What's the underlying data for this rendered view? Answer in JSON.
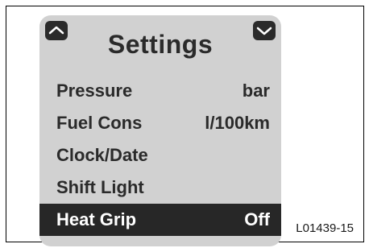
{
  "screen": {
    "title": "Settings",
    "nav": {
      "up_icon": "chevron-up-icon",
      "down_icon": "chevron-down-icon"
    },
    "items": [
      {
        "label": "Pressure",
        "value": "bar",
        "selected": false
      },
      {
        "label": "Fuel Cons",
        "value": "l/100km",
        "selected": false
      },
      {
        "label": "Clock/Date",
        "value": "",
        "selected": false
      },
      {
        "label": "Shift Light",
        "value": "",
        "selected": false
      },
      {
        "label": "Heat Grip",
        "value": "Off",
        "selected": true
      }
    ]
  },
  "figure_code": "L01439-15",
  "colors": {
    "screen_background": "#d1d1d1",
    "selected_row": "#272727",
    "text": "#2a2a2a",
    "selected_text": "#ffffff"
  }
}
